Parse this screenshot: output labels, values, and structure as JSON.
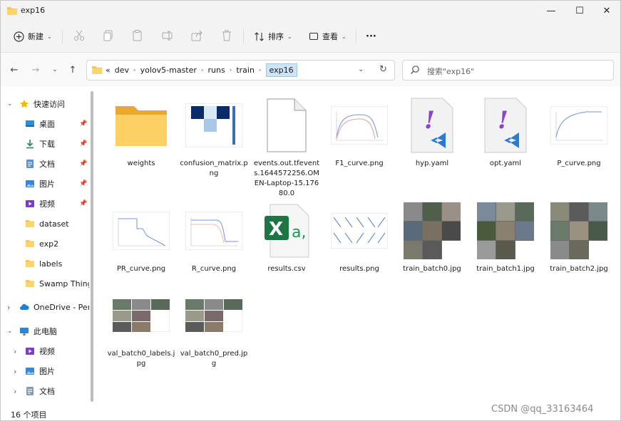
{
  "window": {
    "title": "exp16"
  },
  "toolbar": {
    "new_label": "新建",
    "sort_label": "排序",
    "view_label": "查看",
    "more_label": "···"
  },
  "address": {
    "crumbs": [
      "dev",
      "yolov5-master",
      "runs",
      "train",
      "exp16"
    ],
    "overflow": "«"
  },
  "search": {
    "placeholder": "搜索\"exp16\""
  },
  "sidebar": {
    "quick_access": "快速访问",
    "items": [
      {
        "label": "桌面",
        "icon": "desktop-icon",
        "pinned": true
      },
      {
        "label": "下载",
        "icon": "download-icon",
        "pinned": true
      },
      {
        "label": "文档",
        "icon": "document-icon",
        "pinned": true
      },
      {
        "label": "图片",
        "icon": "pictures-icon",
        "pinned": true
      },
      {
        "label": "视频",
        "icon": "videos-icon",
        "pinned": true
      },
      {
        "label": "dataset",
        "icon": "folder-icon",
        "pinned": false
      },
      {
        "label": "exp2",
        "icon": "folder-icon",
        "pinned": false
      },
      {
        "label": "labels",
        "icon": "folder-icon",
        "pinned": false
      },
      {
        "label": "Swamp Thing",
        "icon": "folder-icon",
        "pinned": false
      }
    ],
    "onedrive": "OneDrive - Pers",
    "this_pc": "此电脑",
    "pc_items": [
      {
        "label": "视频",
        "icon": "videos-icon"
      },
      {
        "label": "图片",
        "icon": "pictures-icon"
      },
      {
        "label": "文档",
        "icon": "document-icon"
      }
    ]
  },
  "files": [
    {
      "name": "weights",
      "kind": "folder"
    },
    {
      "name": "confusion_matrix.png",
      "kind": "matrix"
    },
    {
      "name": "events.out.tfevents.1644572256.OMEN-Laptop-15.17680.0",
      "kind": "blank"
    },
    {
      "name": "F1_curve.png",
      "kind": "curve"
    },
    {
      "name": "hyp.yaml",
      "kind": "yaml"
    },
    {
      "name": "opt.yaml",
      "kind": "yaml"
    },
    {
      "name": "P_curve.png",
      "kind": "curve"
    },
    {
      "name": "PR_curve.png",
      "kind": "curve2"
    },
    {
      "name": "R_curve.png",
      "kind": "curve3"
    },
    {
      "name": "results.csv",
      "kind": "excel"
    },
    {
      "name": "results.png",
      "kind": "results"
    },
    {
      "name": "train_batch0.jpg",
      "kind": "photo"
    },
    {
      "name": "train_batch1.jpg",
      "kind": "photo"
    },
    {
      "name": "train_batch2.jpg",
      "kind": "photo"
    },
    {
      "name": "val_batch0_labels.jpg",
      "kind": "photo2"
    },
    {
      "name": "val_batch0_pred.jpg",
      "kind": "photo2"
    }
  ],
  "status": {
    "count": "16 个项目"
  },
  "watermark": "CSDN @qq_33163464"
}
